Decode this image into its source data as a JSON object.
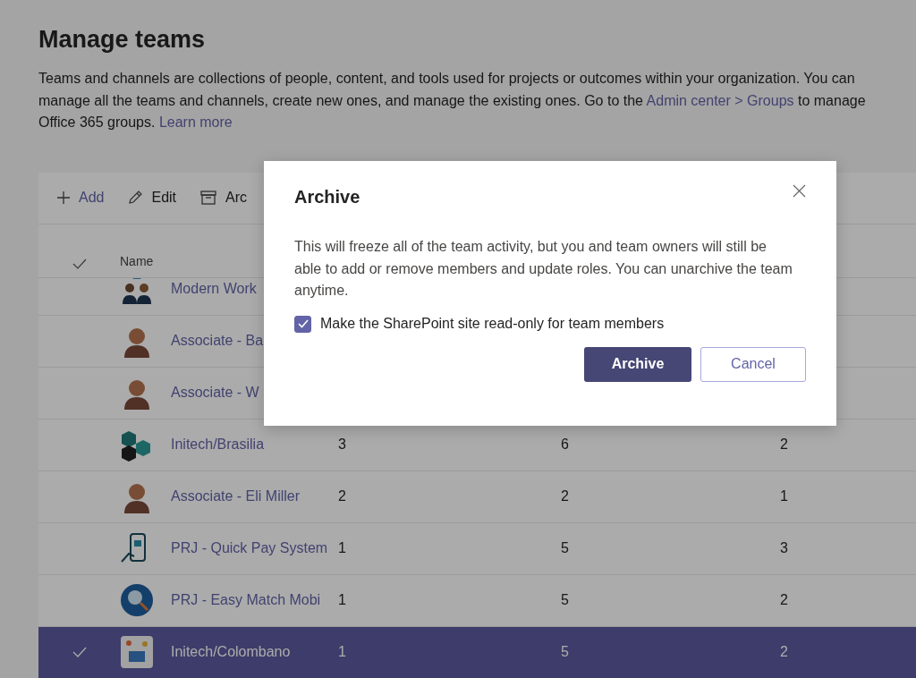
{
  "page": {
    "title": "Manage teams",
    "description": [
      {
        "kind": "text",
        "text": "Teams and channels are collections of people, content, and tools used for projects or outcomes within your organization. You can manage all the teams and channels, create new ones, and manage the existing ones. Go to the "
      },
      {
        "kind": "link",
        "text": "Admin center > Groups"
      },
      {
        "kind": "text",
        "text": " to manage Office 365 groups. "
      },
      {
        "kind": "link",
        "text": "Learn more"
      }
    ]
  },
  "toolbar": [
    {
      "kind": "add",
      "label": "Add"
    },
    {
      "kind": "edit",
      "label": "Edit"
    },
    {
      "kind": "archive",
      "label": "Arc"
    }
  ],
  "table": {
    "columns": [
      {
        "kind": "check"
      },
      {
        "kind": "name",
        "label": "Name"
      }
    ],
    "rows": [
      {
        "name": "Modern Work",
        "selected": false,
        "kind": "people"
      },
      {
        "name": "Associate - Ba",
        "selected": false,
        "kind": "person"
      },
      {
        "name": "Associate - W",
        "selected": false,
        "kind": "person"
      },
      {
        "name": "Initech/Brasilia",
        "cells": [
          "3",
          "6",
          "2"
        ],
        "selected": false,
        "kind": "cubes"
      },
      {
        "name": "Associate - Eli Miller",
        "cells": [
          "2",
          "2",
          "1"
        ],
        "selected": false,
        "kind": "person"
      },
      {
        "name": "PRJ - Quick Pay System",
        "cells": [
          "1",
          "5",
          "3"
        ],
        "selected": false,
        "kind": "phone"
      },
      {
        "name": "PRJ - Easy Match Mobi",
        "cells": [
          "1",
          "5",
          "2"
        ],
        "selected": false,
        "kind": "search"
      },
      {
        "name": "Initech/Colombano",
        "cells": [
          "1",
          "5",
          "2"
        ],
        "selected": true,
        "kind": "collage"
      }
    ]
  },
  "dialog": {
    "title": "Archive",
    "body": "This will freeze all of the team activity, but you and team owners will still be able to add or remove members and update roles. You can unarchive the team anytime.",
    "checkbox": {
      "label": "Make the SharePoint site read-only for team members",
      "checked": true
    },
    "buttons": [
      {
        "kind": "primary",
        "label": "Archive"
      },
      {
        "kind": "secondary",
        "label": "Cancel"
      }
    ]
  }
}
